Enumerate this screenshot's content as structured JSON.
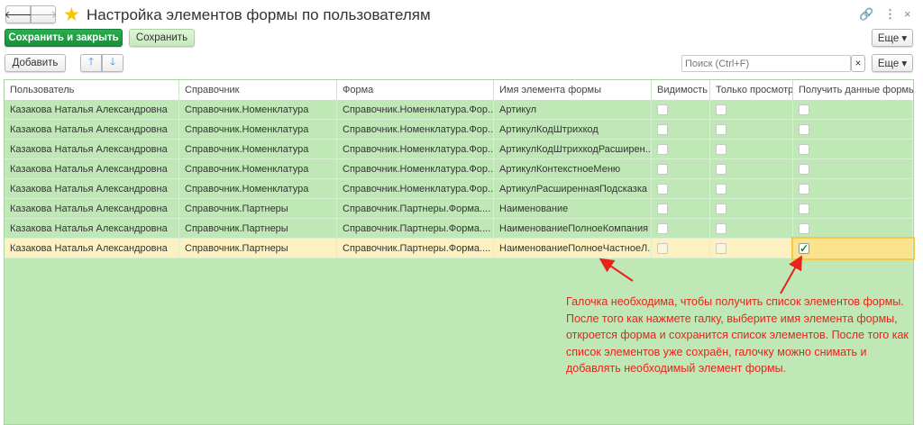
{
  "window": {
    "title": "Настройка элементов формы по пользователям",
    "back_icon": "arrow-left",
    "forward_icon": "arrow-right",
    "favorite_icon": "star"
  },
  "toolbar": {
    "save_close": "Сохранить и закрыть",
    "save": "Сохранить",
    "more": "Еще ▾",
    "add": "Добавить",
    "up_icon": "arrow-up",
    "down_icon": "arrow-down",
    "search_placeholder": "Поиск (Ctrl+F)",
    "search_clear": "×",
    "more2": "Еще ▾"
  },
  "table": {
    "columns": [
      "Пользователь",
      "Справочник",
      "Форма",
      "Имя элемента формы",
      "Видимость",
      "Только просмотр",
      "Получить данные формы"
    ],
    "rows": [
      {
        "user": "Казакова Наталья Александровна",
        "catalog": "Справочник.Номенклатура",
        "form": "Справочник.Номенклатура.Фор...",
        "element": "Артикул",
        "visible": false,
        "readonly": false,
        "get_data": false
      },
      {
        "user": "Казакова Наталья Александровна",
        "catalog": "Справочник.Номенклатура",
        "form": "Справочник.Номенклатура.Фор...",
        "element": "АртикулКодШтрихкод",
        "visible": false,
        "readonly": false,
        "get_data": false
      },
      {
        "user": "Казакова Наталья Александровна",
        "catalog": "Справочник.Номенклатура",
        "form": "Справочник.Номенклатура.Фор...",
        "element": "АртикулКодШтрихкодРасширен...",
        "visible": false,
        "readonly": false,
        "get_data": false
      },
      {
        "user": "Казакова Наталья Александровна",
        "catalog": "Справочник.Номенклатура",
        "form": "Справочник.Номенклатура.Фор...",
        "element": "АртикулКонтекстноеМеню",
        "visible": false,
        "readonly": false,
        "get_data": false
      },
      {
        "user": "Казакова Наталья Александровна",
        "catalog": "Справочник.Номенклатура",
        "form": "Справочник.Номенклатура.Фор...",
        "element": "АртикулРасширеннаяПодсказка",
        "visible": false,
        "readonly": false,
        "get_data": false
      },
      {
        "user": "Казакова Наталья Александровна",
        "catalog": "Справочник.Партнеры",
        "form": "Справочник.Партнеры.Форма....",
        "element": "Наименование",
        "visible": false,
        "readonly": false,
        "get_data": false
      },
      {
        "user": "Казакова Наталья Александровна",
        "catalog": "Справочник.Партнеры",
        "form": "Справочник.Партнеры.Форма....",
        "element": "НаименованиеПолноеКомпания",
        "visible": false,
        "readonly": false,
        "get_data": false
      },
      {
        "user": "Казакова Наталья Александровна",
        "catalog": "Справочник.Партнеры",
        "form": "Справочник.Партнеры.Форма....",
        "element": "НаименованиеПолноеЧастноеЛ...",
        "visible": false,
        "readonly": false,
        "get_data": true
      }
    ]
  },
  "annotation": "Галочка необходима, чтобы получить список элементов формы. После того как нажмете галку, выберите имя элемента формы, откроется форма и сохранится список элементов. После того как список элементов уже сохраён, галочку можно снимать и добавлять необходимый элемент формы.",
  "colors": {
    "accent": "#1a9a3c",
    "row_bg": "#bfe8b6",
    "selected_row": "#fdf1c2",
    "annotation": "#e8231b"
  }
}
